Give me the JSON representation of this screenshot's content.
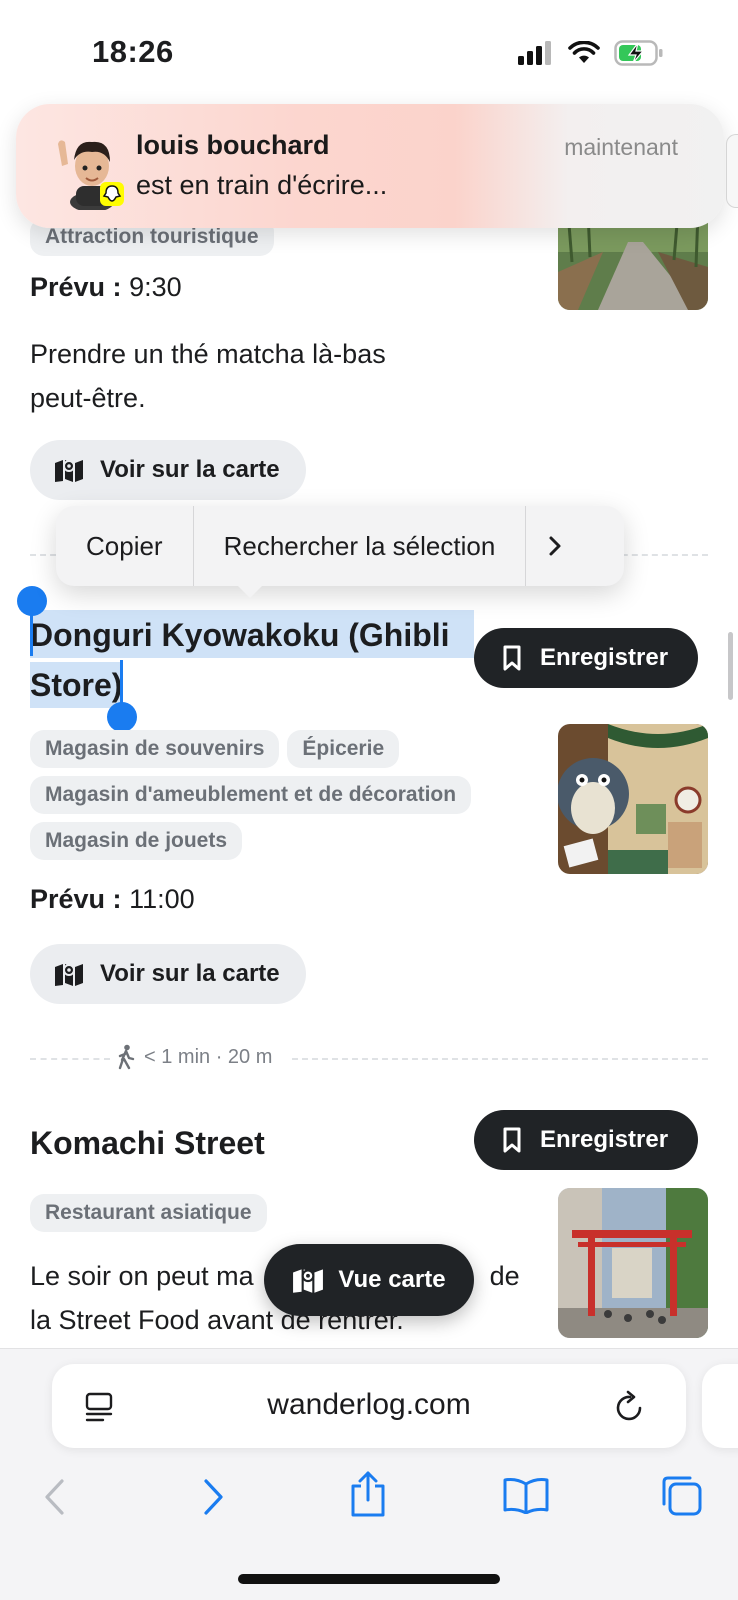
{
  "status_bar": {
    "time": "18:26"
  },
  "notification": {
    "sender": "louis bouchard",
    "message": "est en train d'écrire...",
    "time": "maintenant"
  },
  "item1": {
    "chip": "Attraction touristique",
    "planned_label": "Prévu :",
    "planned_time": "9:30",
    "note_line1": "Prendre un thé matcha là-bas",
    "note_line2": "peut-être.",
    "map_button": "Voir sur la carte"
  },
  "context_menu": {
    "copy": "Copier",
    "search": "Rechercher la sélection"
  },
  "item2": {
    "title_line1": "Donguri Kyowakoku (Ghibli",
    "title_line2": "Store)",
    "save_button": "Enregistrer",
    "chips": [
      "Magasin de souvenirs",
      "Épicerie",
      "Magasin d'ameublement et de décoration",
      "Magasin de jouets"
    ],
    "planned_label": "Prévu :",
    "planned_time": "11:00",
    "map_button": "Voir sur la carte"
  },
  "walk": {
    "text": "< 1 min · 20 m"
  },
  "item3": {
    "title": "Komachi Street",
    "save_button": "Enregistrer",
    "chip": "Restaurant asiatique",
    "note_line1_a": "Le soir on peut ma",
    "note_line1_b": "de",
    "note_line2": "la Street Food avant de rentrer."
  },
  "float_button": {
    "label": "Vue carte"
  },
  "browser": {
    "url": "wanderlog.com"
  }
}
